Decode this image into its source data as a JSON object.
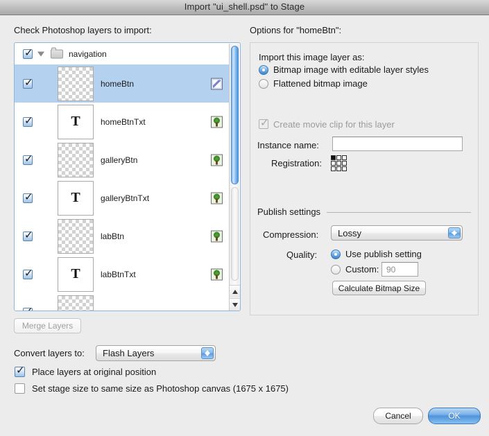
{
  "window": {
    "title": "Import \"ui_shell.psd\" to Stage"
  },
  "left": {
    "heading": "Check Photoshop layers to import:",
    "merge_button": "Merge Layers",
    "rows": [
      {
        "type": "group",
        "name": "navigation",
        "checked": true,
        "expanded": true,
        "icon": "folder-icon"
      },
      {
        "type": "bitmap",
        "name": "homeBtn",
        "checked": true,
        "selected": true,
        "thumb": "alpha",
        "icon": "bitmap-image-icon"
      },
      {
        "type": "text",
        "name": "homeBtnTxt",
        "checked": true,
        "selected": false,
        "thumb": "text",
        "thumb_glyph": "T",
        "icon": "tree-image-icon"
      },
      {
        "type": "bitmap",
        "name": "galleryBtn",
        "checked": true,
        "selected": false,
        "thumb": "alpha",
        "icon": "tree-image-icon"
      },
      {
        "type": "text",
        "name": "galleryBtnTxt",
        "checked": true,
        "selected": false,
        "thumb": "text",
        "thumb_glyph": "T",
        "icon": "tree-image-icon"
      },
      {
        "type": "bitmap",
        "name": "labBtn",
        "checked": true,
        "selected": false,
        "thumb": "alpha",
        "icon": "tree-image-icon"
      },
      {
        "type": "text",
        "name": "labBtnTxt",
        "checked": true,
        "selected": false,
        "thumb": "text",
        "thumb_glyph": "T",
        "icon": "tree-image-icon"
      }
    ]
  },
  "options": {
    "heading": "Options for \"homeBtn\":",
    "import_as_label": "Import this image layer as:",
    "import_as_options": [
      "Bitmap image with editable layer styles",
      "Flattened bitmap image"
    ],
    "import_as_selected": "Bitmap image with editable layer styles",
    "movie_clip_label": "Create movie clip for this layer",
    "movie_clip_checked": true,
    "movie_clip_disabled": true,
    "instance_name_label": "Instance name:",
    "instance_name_value": "",
    "registration_label": "Registration:",
    "registration_point": "top-left",
    "publish_group_label": "Publish settings",
    "compression_label": "Compression:",
    "compression_value": "Lossy",
    "quality_label": "Quality:",
    "quality_options": [
      "Use publish setting",
      "Custom:"
    ],
    "quality_selected": "Use publish setting",
    "custom_quality_value": "90",
    "calculate_button": "Calculate Bitmap Size"
  },
  "bottom": {
    "convert_label": "Convert layers to:",
    "convert_value": "Flash Layers",
    "place_layers_label": "Place layers at original position",
    "place_layers_checked": true,
    "set_stage_label": "Set stage size to same size as Photoshop canvas (1675 x 1675)",
    "set_stage_checked": false,
    "cancel_button": "Cancel",
    "ok_button": "OK"
  }
}
